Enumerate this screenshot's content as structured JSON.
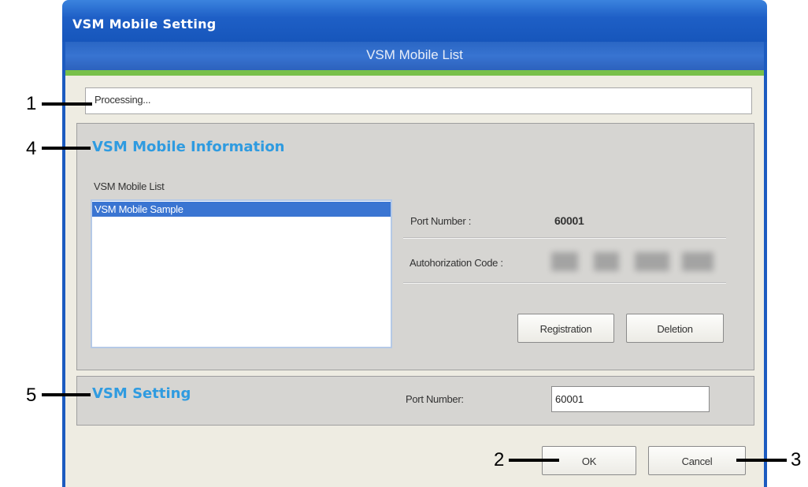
{
  "window": {
    "title": "VSM Mobile Setting",
    "banner": "VSM Mobile List"
  },
  "status": {
    "text": "Processing..."
  },
  "mobile_info": {
    "title": "VSM Mobile Information",
    "list_label": "VSM Mobile List",
    "list_items": [
      "VSM Mobile Sample"
    ],
    "port_label": "Port Number :",
    "port_value": "60001",
    "auth_label": "Autohorization Code :",
    "registration_button": "Registration",
    "deletion_button": "Deletion"
  },
  "vsm_setting": {
    "title": "VSM Setting",
    "port_label": "Port Number:",
    "port_value": "60001"
  },
  "footer": {
    "ok_button": "OK",
    "cancel_button": "Cancel"
  },
  "callouts": {
    "c1": "1",
    "c2": "2",
    "c3": "3",
    "c4": "4",
    "c5": "5"
  },
  "colors": {
    "accent": "#2f9be0",
    "titlebar": "#1e5fc6",
    "banner_stripe": "#78c04a",
    "selection": "#3a75d2"
  }
}
